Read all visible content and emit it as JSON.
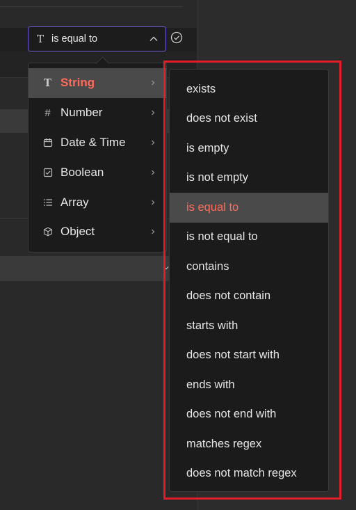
{
  "select": {
    "icon": "text-type-icon",
    "value": "is equal to"
  },
  "type_menu": {
    "items": [
      {
        "label": "String",
        "icon": "text-type-icon",
        "active": true
      },
      {
        "label": "Number",
        "icon": "hash-icon",
        "active": false
      },
      {
        "label": "Date & Time",
        "icon": "calendar-icon",
        "active": false
      },
      {
        "label": "Boolean",
        "icon": "checkbox-icon",
        "active": false
      },
      {
        "label": "Array",
        "icon": "list-icon",
        "active": false
      },
      {
        "label": "Object",
        "icon": "cube-icon",
        "active": false
      }
    ]
  },
  "operator_menu": {
    "items": [
      {
        "label": "exists",
        "active": false
      },
      {
        "label": "does not exist",
        "active": false
      },
      {
        "label": "is empty",
        "active": false
      },
      {
        "label": "is not empty",
        "active": false
      },
      {
        "label": "is equal to",
        "active": true
      },
      {
        "label": "is not equal to",
        "active": false
      },
      {
        "label": "contains",
        "active": false
      },
      {
        "label": "does not contain",
        "active": false
      },
      {
        "label": "starts with",
        "active": false
      },
      {
        "label": "does not start with",
        "active": false
      },
      {
        "label": "ends with",
        "active": false
      },
      {
        "label": "does not end with",
        "active": false
      },
      {
        "label": "matches regex",
        "active": false
      },
      {
        "label": "does not match regex",
        "active": false
      }
    ]
  },
  "colors": {
    "accent": "#ff6b5b",
    "focus_border": "#6a5bd6",
    "highlight": "#e11d2a"
  }
}
